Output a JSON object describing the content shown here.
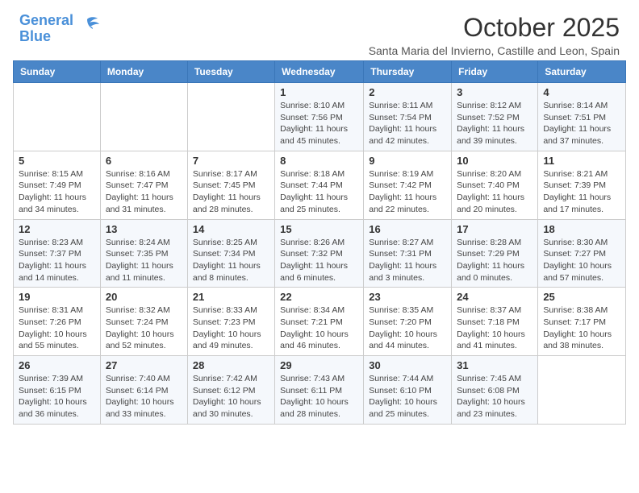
{
  "header": {
    "logo_line1": "General",
    "logo_line2": "Blue",
    "month_title": "October 2025",
    "subtitle": "Santa Maria del Invierno, Castille and Leon, Spain"
  },
  "days_of_week": [
    "Sunday",
    "Monday",
    "Tuesday",
    "Wednesday",
    "Thursday",
    "Friday",
    "Saturday"
  ],
  "weeks": [
    [
      {
        "day": "",
        "info": ""
      },
      {
        "day": "",
        "info": ""
      },
      {
        "day": "",
        "info": ""
      },
      {
        "day": "1",
        "info": "Sunrise: 8:10 AM\nSunset: 7:56 PM\nDaylight: 11 hours and 45 minutes."
      },
      {
        "day": "2",
        "info": "Sunrise: 8:11 AM\nSunset: 7:54 PM\nDaylight: 11 hours and 42 minutes."
      },
      {
        "day": "3",
        "info": "Sunrise: 8:12 AM\nSunset: 7:52 PM\nDaylight: 11 hours and 39 minutes."
      },
      {
        "day": "4",
        "info": "Sunrise: 8:14 AM\nSunset: 7:51 PM\nDaylight: 11 hours and 37 minutes."
      }
    ],
    [
      {
        "day": "5",
        "info": "Sunrise: 8:15 AM\nSunset: 7:49 PM\nDaylight: 11 hours and 34 minutes."
      },
      {
        "day": "6",
        "info": "Sunrise: 8:16 AM\nSunset: 7:47 PM\nDaylight: 11 hours and 31 minutes."
      },
      {
        "day": "7",
        "info": "Sunrise: 8:17 AM\nSunset: 7:45 PM\nDaylight: 11 hours and 28 minutes."
      },
      {
        "day": "8",
        "info": "Sunrise: 8:18 AM\nSunset: 7:44 PM\nDaylight: 11 hours and 25 minutes."
      },
      {
        "day": "9",
        "info": "Sunrise: 8:19 AM\nSunset: 7:42 PM\nDaylight: 11 hours and 22 minutes."
      },
      {
        "day": "10",
        "info": "Sunrise: 8:20 AM\nSunset: 7:40 PM\nDaylight: 11 hours and 20 minutes."
      },
      {
        "day": "11",
        "info": "Sunrise: 8:21 AM\nSunset: 7:39 PM\nDaylight: 11 hours and 17 minutes."
      }
    ],
    [
      {
        "day": "12",
        "info": "Sunrise: 8:23 AM\nSunset: 7:37 PM\nDaylight: 11 hours and 14 minutes."
      },
      {
        "day": "13",
        "info": "Sunrise: 8:24 AM\nSunset: 7:35 PM\nDaylight: 11 hours and 11 minutes."
      },
      {
        "day": "14",
        "info": "Sunrise: 8:25 AM\nSunset: 7:34 PM\nDaylight: 11 hours and 8 minutes."
      },
      {
        "day": "15",
        "info": "Sunrise: 8:26 AM\nSunset: 7:32 PM\nDaylight: 11 hours and 6 minutes."
      },
      {
        "day": "16",
        "info": "Sunrise: 8:27 AM\nSunset: 7:31 PM\nDaylight: 11 hours and 3 minutes."
      },
      {
        "day": "17",
        "info": "Sunrise: 8:28 AM\nSunset: 7:29 PM\nDaylight: 11 hours and 0 minutes."
      },
      {
        "day": "18",
        "info": "Sunrise: 8:30 AM\nSunset: 7:27 PM\nDaylight: 10 hours and 57 minutes."
      }
    ],
    [
      {
        "day": "19",
        "info": "Sunrise: 8:31 AM\nSunset: 7:26 PM\nDaylight: 10 hours and 55 minutes."
      },
      {
        "day": "20",
        "info": "Sunrise: 8:32 AM\nSunset: 7:24 PM\nDaylight: 10 hours and 52 minutes."
      },
      {
        "day": "21",
        "info": "Sunrise: 8:33 AM\nSunset: 7:23 PM\nDaylight: 10 hours and 49 minutes."
      },
      {
        "day": "22",
        "info": "Sunrise: 8:34 AM\nSunset: 7:21 PM\nDaylight: 10 hours and 46 minutes."
      },
      {
        "day": "23",
        "info": "Sunrise: 8:35 AM\nSunset: 7:20 PM\nDaylight: 10 hours and 44 minutes."
      },
      {
        "day": "24",
        "info": "Sunrise: 8:37 AM\nSunset: 7:18 PM\nDaylight: 10 hours and 41 minutes."
      },
      {
        "day": "25",
        "info": "Sunrise: 8:38 AM\nSunset: 7:17 PM\nDaylight: 10 hours and 38 minutes."
      }
    ],
    [
      {
        "day": "26",
        "info": "Sunrise: 7:39 AM\nSunset: 6:15 PM\nDaylight: 10 hours and 36 minutes."
      },
      {
        "day": "27",
        "info": "Sunrise: 7:40 AM\nSunset: 6:14 PM\nDaylight: 10 hours and 33 minutes."
      },
      {
        "day": "28",
        "info": "Sunrise: 7:42 AM\nSunset: 6:12 PM\nDaylight: 10 hours and 30 minutes."
      },
      {
        "day": "29",
        "info": "Sunrise: 7:43 AM\nSunset: 6:11 PM\nDaylight: 10 hours and 28 minutes."
      },
      {
        "day": "30",
        "info": "Sunrise: 7:44 AM\nSunset: 6:10 PM\nDaylight: 10 hours and 25 minutes."
      },
      {
        "day": "31",
        "info": "Sunrise: 7:45 AM\nSunset: 6:08 PM\nDaylight: 10 hours and 23 minutes."
      },
      {
        "day": "",
        "info": ""
      }
    ]
  ]
}
